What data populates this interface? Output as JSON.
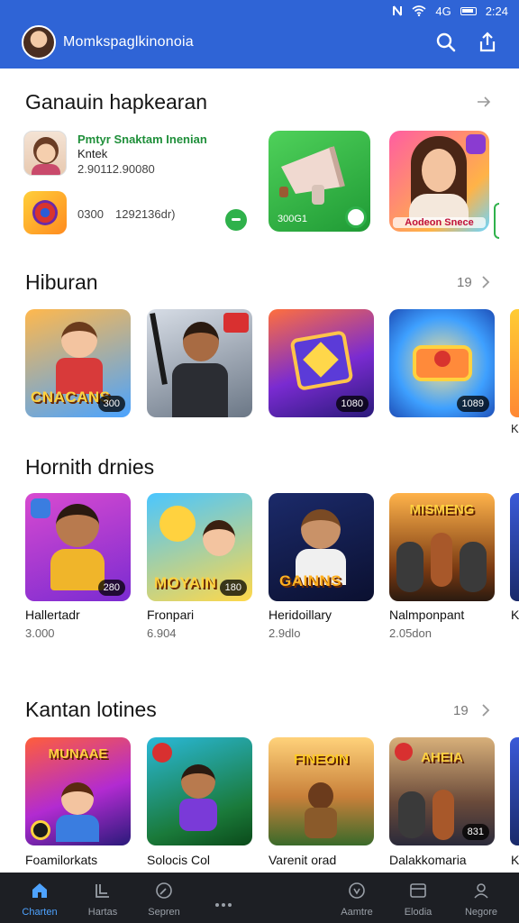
{
  "status_bar": {
    "signal": "4G",
    "time": "2:24"
  },
  "app_bar": {
    "title": "Momkspaglkinonoia"
  },
  "featured": {
    "title": "Ganauin hapkearan",
    "app1": {
      "name": "Pmtyr Snaktam Inenian",
      "sub": "Kntek",
      "meta": "2.90112.90080"
    },
    "app2": {
      "meta_left": "0300",
      "meta_right": "1292136dr)"
    },
    "tile_green_label": "300G1",
    "tile_girl_label": "Aodeon Snece"
  },
  "hiburan": {
    "title": "Hiburan",
    "count": "19",
    "tiles": [
      {
        "overlay": "CNACANS",
        "badge": "300"
      },
      {
        "overlay": "",
        "badge": ""
      },
      {
        "overlay": "",
        "badge": "1080"
      },
      {
        "overlay": "",
        "badge": "1089"
      }
    ],
    "peek_label": "K"
  },
  "hornith": {
    "title": "Hornith drnies",
    "items": [
      {
        "name": "Hallertadr",
        "meta": "3.000",
        "badge": "280",
        "overlay": ""
      },
      {
        "name": "Fronpari",
        "meta": "6.904",
        "badge": "180",
        "overlay": "MOYAIN"
      },
      {
        "name": "Heridoillary",
        "meta": "2.9dlo",
        "badge": "",
        "overlay": "GAINNS"
      },
      {
        "name": "Nalmponpant",
        "meta": "2.05don",
        "badge": "",
        "overlay": "MISMENG"
      }
    ],
    "peek_label": "K"
  },
  "kantan": {
    "title": "Kantan lotines",
    "count": "19",
    "items": [
      {
        "name": "Foamilorkats",
        "top": "MUNAAE"
      },
      {
        "name": "Solocis Col",
        "top": ""
      },
      {
        "name": "Varenit orad",
        "top": "FINEOIN"
      },
      {
        "name": "Dalakkomaria",
        "top": "AHEIA",
        "badge": "831"
      }
    ],
    "peek_label": "K"
  },
  "bottom_nav": [
    {
      "label": "Charten",
      "icon": "home-icon",
      "active": true
    },
    {
      "label": "Hartas",
      "icon": "apps-icon",
      "active": false
    },
    {
      "label": "Sepren",
      "icon": "compass-icon",
      "active": false
    },
    {
      "label": "",
      "icon": "more-icon",
      "active": false
    },
    {
      "label": "Aamtre",
      "icon": "download-icon",
      "active": false
    },
    {
      "label": "Elodia",
      "icon": "library-icon",
      "active": false
    },
    {
      "label": "Negore",
      "icon": "profile-icon",
      "active": false
    }
  ],
  "colors": {
    "app_bar": "#2f64d6",
    "bottom_nav": "#1d1f24",
    "accent_green": "#2fb14b",
    "active_nav": "#4ea3ff"
  }
}
